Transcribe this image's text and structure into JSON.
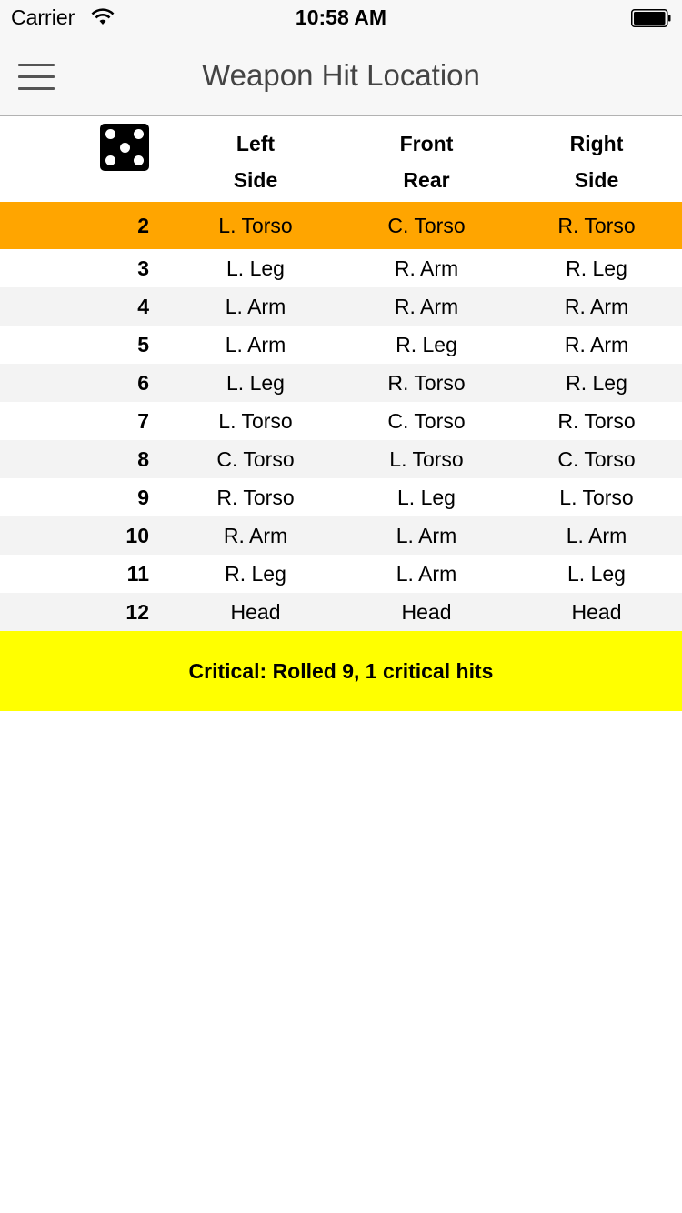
{
  "status_bar": {
    "carrier": "Carrier",
    "time": "10:58 AM",
    "wifi_icon": "wifi-icon",
    "battery_icon": "battery-icon"
  },
  "nav": {
    "title": "Weapon Hit Location",
    "menu_icon": "hamburger-menu-icon"
  },
  "table": {
    "dice_icon": "dice-five-icon",
    "columns": [
      {
        "line1": "Left",
        "line2": "Side"
      },
      {
        "line1": "Front",
        "line2": "Rear"
      },
      {
        "line1": "Right",
        "line2": "Side"
      }
    ],
    "rows": [
      {
        "roll": "2",
        "cells": [
          "L. Torso",
          "C. Torso",
          "R. Torso"
        ]
      },
      {
        "roll": "3",
        "cells": [
          "L. Leg",
          "R. Arm",
          "R. Leg"
        ]
      },
      {
        "roll": "4",
        "cells": [
          "L. Arm",
          "R. Arm",
          "R. Arm"
        ]
      },
      {
        "roll": "5",
        "cells": [
          "L. Arm",
          "R. Leg",
          "R. Arm"
        ]
      },
      {
        "roll": "6",
        "cells": [
          "L. Leg",
          "R. Torso",
          "R. Leg"
        ]
      },
      {
        "roll": "7",
        "cells": [
          "L. Torso",
          "C. Torso",
          "R. Torso"
        ]
      },
      {
        "roll": "8",
        "cells": [
          "C. Torso",
          "L. Torso",
          "C. Torso"
        ]
      },
      {
        "roll": "9",
        "cells": [
          "R. Torso",
          "L. Leg",
          "L. Torso"
        ]
      },
      {
        "roll": "10",
        "cells": [
          "R. Arm",
          "L. Arm",
          "L. Arm"
        ]
      },
      {
        "roll": "11",
        "cells": [
          "R. Leg",
          "L. Arm",
          "L. Leg"
        ]
      },
      {
        "roll": "12",
        "cells": [
          "Head",
          "Head",
          "Head"
        ]
      }
    ],
    "highlight_color": "#ffa500",
    "alt_row_color": "#f3f3f3"
  },
  "critical": {
    "text": "Critical: Rolled 9, 1 critical hits",
    "color": "#ffff00"
  }
}
